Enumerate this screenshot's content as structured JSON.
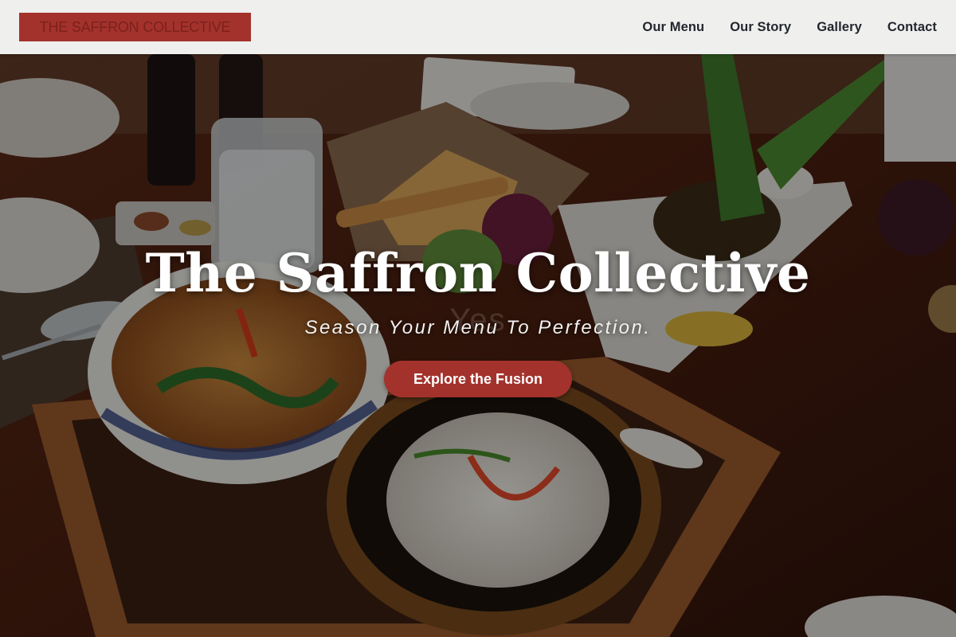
{
  "header": {
    "logo_text": "THE SAFFRON COLLECTIVE",
    "nav": [
      {
        "label": "Our Menu"
      },
      {
        "label": "Our Story"
      },
      {
        "label": "Gallery"
      },
      {
        "label": "Contact"
      }
    ]
  },
  "hero": {
    "title": "The Saffron Collective",
    "ghost_text": "Yes",
    "tagline": "Season Your Menu To Perfection.",
    "cta_label": "Explore the Fusion"
  },
  "colors": {
    "accent": "#a3322c",
    "header_bg": "#efefee",
    "nav_text": "#22262d"
  }
}
